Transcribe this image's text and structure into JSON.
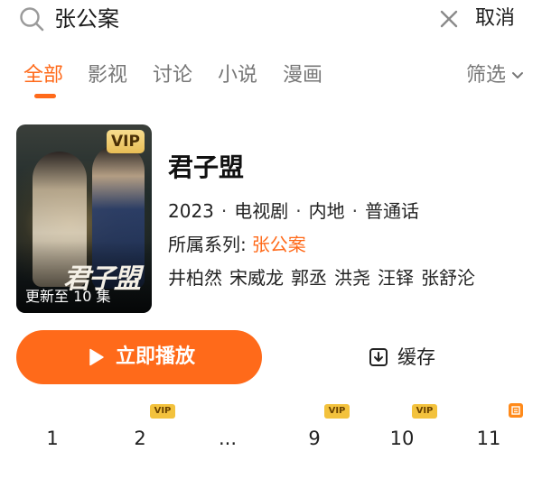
{
  "search": {
    "query": "张公案",
    "cancel_label": "取消"
  },
  "tabs": {
    "items": [
      {
        "label": "全部",
        "active": true
      },
      {
        "label": "影视",
        "active": false
      },
      {
        "label": "讨论",
        "active": false
      },
      {
        "label": "小说",
        "active": false
      },
      {
        "label": "漫画",
        "active": false
      }
    ],
    "filter_label": "筛选"
  },
  "result": {
    "poster": {
      "vip_badge": "VIP",
      "update_status": "更新至 10 集",
      "calligraphy": "君子盟"
    },
    "title": "君子盟",
    "meta": [
      "2023",
      "电视剧",
      "内地",
      "普通话"
    ],
    "series_label": "所属系列:",
    "series_name": "张公案",
    "cast": [
      "井柏然",
      "宋威龙",
      "郭丞",
      "洪尧",
      "汪铎",
      "张舒沦"
    ],
    "play_label": "立即播放",
    "cache_label": "缓存"
  },
  "episodes": [
    {
      "label": "1",
      "badge": ""
    },
    {
      "label": "2",
      "badge": "VIP"
    },
    {
      "label": "...",
      "badge": ""
    },
    {
      "label": "9",
      "badge": "VIP"
    },
    {
      "label": "10",
      "badge": "VIP"
    },
    {
      "label": "11",
      "badge": "new-icon"
    }
  ],
  "colors": {
    "accent": "#ff6a1a",
    "vip_gold": "#f3c23d",
    "text_primary": "#1a1a1a",
    "text_secondary": "#777777"
  }
}
